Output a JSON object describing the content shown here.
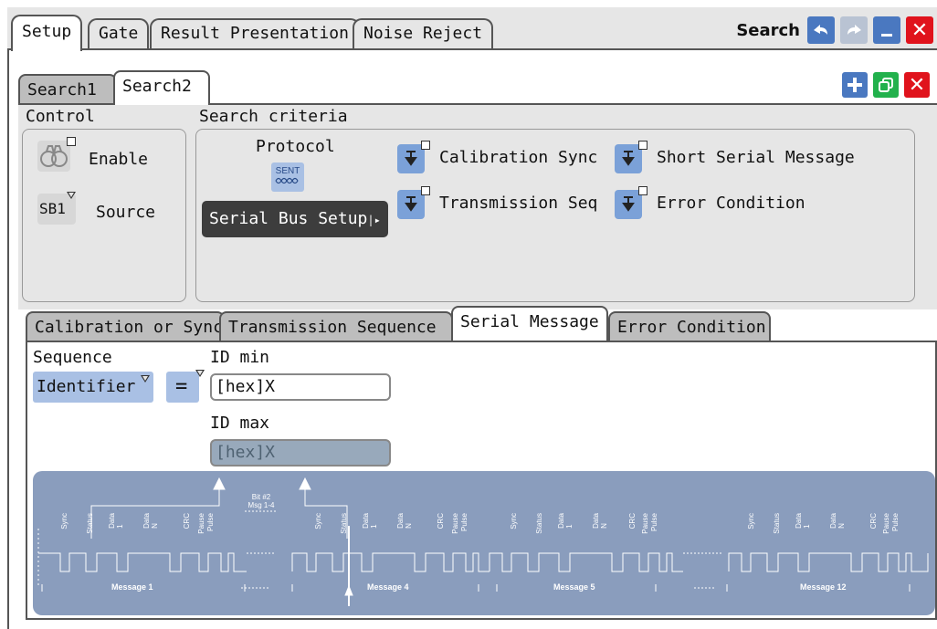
{
  "window": {
    "title": "Search",
    "tabs": [
      "Setup",
      "Gate",
      "Result Presentation",
      "Noise Reject"
    ],
    "active_tab": "Setup"
  },
  "search_tabs": {
    "items": [
      "Search1",
      "Search2"
    ],
    "active": "Search2"
  },
  "control": {
    "heading": "Control",
    "enable_label": "Enable",
    "source_label": "Source",
    "source_value": "SB1"
  },
  "criteria": {
    "heading": "Search criteria",
    "protocol_label": "Protocol",
    "protocol_icon_text": "SENT",
    "serial_bus_setup": "Serial Bus Setup",
    "items": [
      "Calibration Sync",
      "Transmission Seq",
      "Short Serial Message",
      "Error Condition"
    ]
  },
  "detail_tabs": {
    "items": [
      "Calibration or Sync",
      "Transmission Sequence",
      "Serial Message",
      "Error Condition"
    ],
    "active": "Serial Message"
  },
  "serial_message": {
    "sequence_label": "Sequence",
    "sequence_value": "Identifier",
    "operator_value": "=",
    "id_min_label": "ID min",
    "id_min_value": "[hex]X",
    "id_max_label": "ID max",
    "id_max_value": "[hex]X"
  },
  "diagram": {
    "bit_label_1": "Bit #2",
    "bit_label_2": "Msg 1-4",
    "field_labels": [
      "Sync",
      "Status",
      "Data 1",
      "Data N",
      "CRC",
      "Pause",
      "Pulse"
    ],
    "messages": [
      "Message 1",
      "Message 4",
      "Message 5",
      "Message 12"
    ],
    "colors": {
      "background": "#8a9dbd",
      "lines": "#ffffff"
    }
  }
}
